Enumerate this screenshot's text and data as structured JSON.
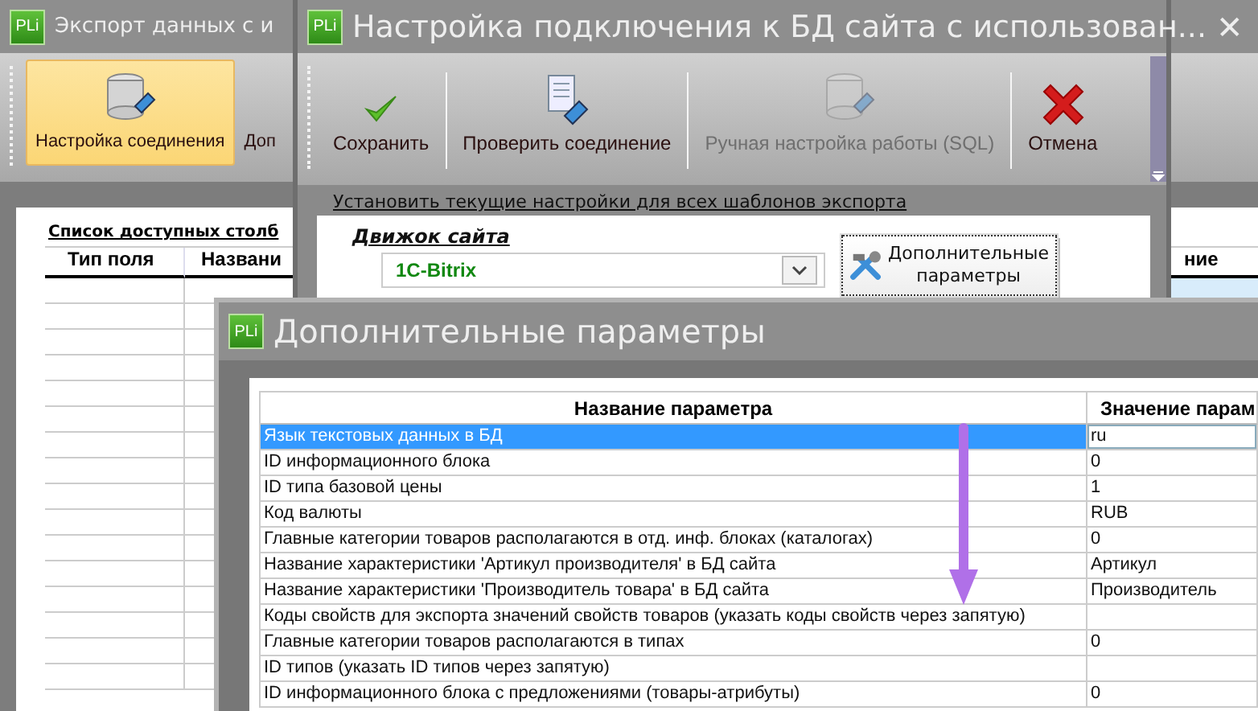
{
  "main_window": {
    "logo": "PLi",
    "title": "Экспорт данных с и",
    "toolbar": [
      {
        "label": "Настройка соединения",
        "kind": "database",
        "selected": true
      },
      {
        "label": "Доп",
        "kind": "none",
        "selected": false
      }
    ],
    "caption": "Список доступных столб",
    "table": {
      "columns": [
        "Тип поля",
        "Названи",
        "ние"
      ]
    }
  },
  "connection_dialog": {
    "logo": "PLi",
    "title": "Настройка подключения к БД сайта с использован...",
    "close": "✕",
    "toolbar": [
      {
        "label": "Сохранить",
        "kind": "check",
        "disabled": false
      },
      {
        "label": "Проверить соединение",
        "kind": "document",
        "disabled": false
      },
      {
        "label": "Ручная настройка работы (SQL)",
        "kind": "database",
        "disabled": true
      },
      {
        "label": "Отмена",
        "kind": "cross",
        "disabled": false
      }
    ],
    "apply_link": "Установить текущие настройки для всех шаблонов экспорта",
    "engine_label": "Движок сайта",
    "engine_select": {
      "value": "1C-Bitrix"
    },
    "extra_button": "Дополнительные параметры"
  },
  "params_dialog": {
    "logo": "PLi",
    "title": "Дополнительные параметры",
    "columns": [
      "Название параметра",
      "Значение парам"
    ],
    "rows": [
      {
        "name": "Язык текстовых данных в БД",
        "value": "ru",
        "selected": true
      },
      {
        "name": "ID информационного блока",
        "value": "0",
        "selected": false
      },
      {
        "name": "ID типа базовой цены",
        "value": "1",
        "selected": false
      },
      {
        "name": "Код валюты",
        "value": "RUB",
        "selected": false
      },
      {
        "name": "Главные категории товаров располагаются в отд. инф. блоках (каталогах)",
        "value": "0",
        "selected": false
      },
      {
        "name": "Название характеристики 'Артикул производителя' в БД сайта",
        "value": "Артикул",
        "selected": false
      },
      {
        "name": "Название характеристики 'Производитель товара' в БД сайта",
        "value": "Производитель",
        "selected": false
      },
      {
        "name": "Коды свойств для экспорта значений свойств товаров (указать коды свойств через запятую)",
        "value": "",
        "selected": false
      },
      {
        "name": "Главные категории товаров располагаются в типах",
        "value": "0",
        "selected": false
      },
      {
        "name": "ID типов (указать ID типов через запятую)",
        "value": "",
        "selected": false
      },
      {
        "name": "ID информационного блока с предложениями (товары-атрибуты)",
        "value": "0",
        "selected": false
      }
    ]
  }
}
